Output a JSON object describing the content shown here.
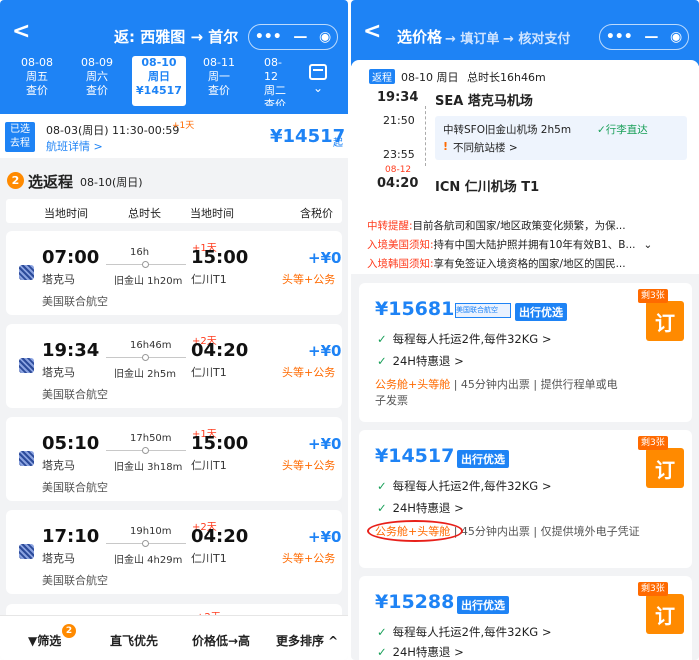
{
  "left": {
    "header": {
      "back": "<",
      "title": "返: 西雅图 → 首尔",
      "caps": [
        "•••",
        "—",
        "◉"
      ]
    },
    "dates": [
      {
        "date": "08-08",
        "weekday": "周五",
        "price": "查价"
      },
      {
        "date": "08-09",
        "weekday": "周六",
        "price": "查价"
      },
      {
        "date": "08-10",
        "weekday": "周日",
        "price": "¥14517"
      },
      {
        "date": "08-11",
        "weekday": "周一",
        "price": "查价"
      },
      {
        "date": "08-12",
        "weekday": "周二",
        "price": "查价"
      }
    ],
    "calendar_arrow": "⌄",
    "outbound": {
      "tag1": "已选",
      "tag2": "去程",
      "info": "08-03(周日) 11:30-00:59",
      "plusday": "+1天",
      "detail": "航班详情 >",
      "price": "¥14517",
      "suffix": "起"
    },
    "return_section": {
      "badge": "2",
      "title": "选返程",
      "date": "08-10(周日)"
    },
    "columns": [
      "当地时间",
      "总时长",
      "当地时间",
      "含税价"
    ],
    "flights": [
      {
        "dep": "07:00",
        "dep_ap": "塔克马",
        "dur": "16h",
        "stop": "旧金山 1h20m",
        "plus": "+1天",
        "arr": "15:00",
        "arr_ap": "仁川T1",
        "price": "+¥0",
        "cabin": "头等+公务",
        "airline": "美国联合航空"
      },
      {
        "dep": "19:34",
        "dep_ap": "塔克马",
        "dur": "16h46m",
        "stop": "旧金山 2h5m",
        "plus": "+2天",
        "arr": "04:20",
        "arr_ap": "仁川T1",
        "price": "+¥0",
        "cabin": "头等+公务",
        "airline": "美国联合航空"
      },
      {
        "dep": "05:10",
        "dep_ap": "塔克马",
        "dur": "17h50m",
        "stop": "旧金山 3h18m",
        "plus": "+1天",
        "arr": "15:00",
        "arr_ap": "仁川T1",
        "price": "+¥0",
        "cabin": "头等+公务",
        "airline": "美国联合航空"
      },
      {
        "dep": "17:10",
        "dep_ap": "塔克马",
        "dur": "19h10m",
        "stop": "旧金山 4h29m",
        "plus": "+2天",
        "arr": "04:20",
        "arr_ap": "仁川T1",
        "price": "+¥0",
        "cabin": "头等+公务",
        "airline": "美国联合航空"
      }
    ],
    "bottom": {
      "filter": "筛选",
      "filter_badge": "2",
      "direct": "直飞优先",
      "sort": "价格低→高",
      "more": "更多排序 ^"
    }
  },
  "right": {
    "header": {
      "back": "<",
      "step1": "选价格",
      "step2": "→ 填订单",
      "step3": "→ 核对支付"
    },
    "segment": {
      "tag": "返程",
      "date": "08-10 周日",
      "total": "总时长16h46m",
      "dep_time": "19:34",
      "dep_ap": "SEA 塔克马机场",
      "t1": "21:50",
      "transfer": "中转SFO旧金山机场 2h5m",
      "transfer_tag": "✓行李直达",
      "warn": "!",
      "diff": "不同航站楼 >",
      "t2": "23:55",
      "arr_date": "08-12",
      "arr_time": "04:20",
      "arr_ap": "ICN 仁川机场 T1"
    },
    "notices": [
      {
        "label": "中转提醒:",
        "text": "目前各航司和国家/地区政策变化频繁，为保..."
      },
      {
        "label": "入境美国须知:",
        "text": "持有中国大陆护照并拥有10年有效B1、B..."
      },
      {
        "label": "入境韩国须知:",
        "text": "享有免签证入境资格的国家/地区的国民..."
      }
    ],
    "offers": [
      {
        "price": "¥15681",
        "sponsor": "美国联合航空",
        "pill": "出行优选",
        "baggage": "每程每人托运2件,每件32KG >",
        "promo": "24H特惠退 >",
        "cabin": "公务舱+头等舱",
        "ticket": "| 45分钟内出票 | 提供行程单或电子发票",
        "remain": "剩3张",
        "book": "订"
      },
      {
        "price": "¥14517",
        "pill": "出行优选",
        "baggage": "每程每人托运2件,每件32KG >",
        "promo": "24H特惠退 >",
        "cabin": "公务舱+头等舱",
        "ticket": "| 45分钟内出票 | 仅提供境外电子凭证",
        "remain": "剩3张",
        "book": "订"
      },
      {
        "price": "¥15288",
        "pill": "出行优选",
        "baggage": "每程每人托运2件,每件32KG >",
        "promo": "24H特惠退 >",
        "remain": "剩3张",
        "book": "订"
      }
    ]
  },
  "colors": {
    "primary": "#1e83f5",
    "orange": "#ff8a00",
    "red": "#ff3b1d",
    "green": "#1aa05a"
  }
}
